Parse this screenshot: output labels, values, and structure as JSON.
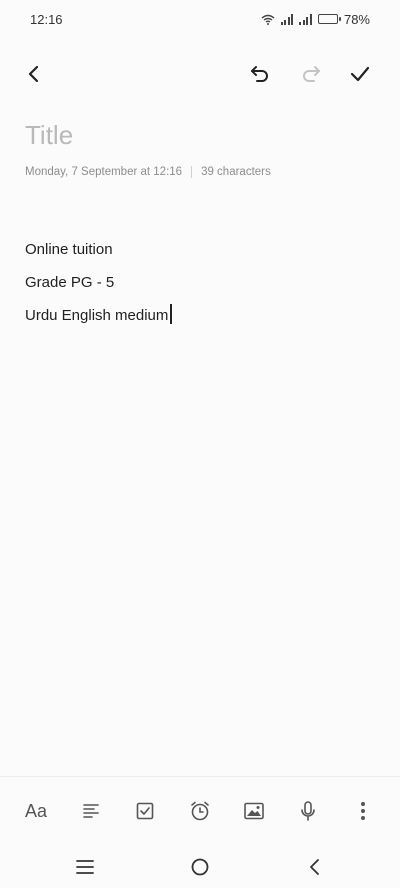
{
  "status_bar": {
    "time": "12:16",
    "battery_percent": "78%",
    "battery_level": 0.78
  },
  "toolbar": {
    "back_icon": "back-arrow-icon",
    "undo_icon": "undo-icon",
    "redo_icon": "redo-icon",
    "confirm_icon": "check-icon"
  },
  "note": {
    "title_placeholder": "Title",
    "date": "Monday, 7 September at 12:16",
    "character_count": "39 characters",
    "lines": [
      "Online tuition",
      "Grade PG - 5",
      "Urdu English medium"
    ]
  },
  "format_bar": {
    "text_style_label": "Aa",
    "icons": [
      "text-align-icon",
      "checkbox-icon",
      "alarm-icon",
      "image-icon",
      "microphone-icon",
      "more-vertical-icon"
    ]
  },
  "nav_bar": {
    "icons": [
      "menu-icon",
      "home-icon",
      "back-icon"
    ]
  },
  "colors": {
    "background": "#fbfbfb",
    "text": "#1f1f1f",
    "placeholder": "#b9b9b9",
    "muted": "#8d8d8d",
    "disabled_icon": "#c4c4c4"
  }
}
